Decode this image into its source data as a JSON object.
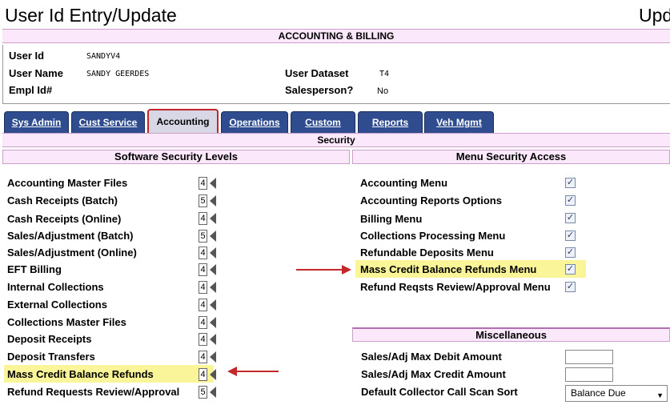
{
  "window": {
    "title": "User Id Entry/Update",
    "title_right": "Upd"
  },
  "section": {
    "title": "ACCOUNTING & BILLING"
  },
  "user_info": {
    "user_id_label": "User Id",
    "user_id_value": "SANDYV4",
    "user_name_label": "User Name",
    "user_name_value": "SANDY GEERDES",
    "empl_id_label": "Empl Id#",
    "user_dataset_label": "User Dataset",
    "user_dataset_value": "T4",
    "salesperson_label": "Salesperson?",
    "salesperson_value": "No"
  },
  "tabs": [
    {
      "label": "Sys Admin",
      "active": false
    },
    {
      "label": "Cust Service",
      "active": false
    },
    {
      "label": "Accounting",
      "active": true
    },
    {
      "label": "Operations",
      "active": false
    },
    {
      "label": "Custom",
      "active": false
    },
    {
      "label": "Reports",
      "active": false
    },
    {
      "label": "Veh Mgmt",
      "active": false
    }
  ],
  "security": {
    "title": "Security"
  },
  "software_levels": {
    "title": "Software Security Levels",
    "items": [
      {
        "label": "Accounting Master Files",
        "level": "4"
      },
      {
        "label": "Cash Receipts (Batch)",
        "level": "5"
      },
      {
        "label": "Cash Receipts (Online)",
        "level": "4"
      },
      {
        "label": "Sales/Adjustment (Batch)",
        "level": "5"
      },
      {
        "label": "Sales/Adjustment (Online)",
        "level": "4"
      },
      {
        "label": "EFT Billing",
        "level": "4"
      },
      {
        "label": "Internal Collections",
        "level": "4"
      },
      {
        "label": "External Collections",
        "level": "4"
      },
      {
        "label": "Collections Master Files",
        "level": "4"
      },
      {
        "label": "Deposit Receipts",
        "level": "4"
      },
      {
        "label": "Deposit Transfers",
        "level": "4"
      },
      {
        "label": "Mass Credit Balance Refunds",
        "level": "4",
        "highlighted": true
      },
      {
        "label": "Refund Requests Review/Approval",
        "level": "5"
      }
    ]
  },
  "menu_access": {
    "title": "Menu Security Access",
    "items": [
      {
        "label": "Accounting Menu",
        "checked": true
      },
      {
        "label": "Accounting Reports Options",
        "checked": true
      },
      {
        "label": "Billing Menu",
        "checked": true
      },
      {
        "label": "Collections Processing Menu",
        "checked": true
      },
      {
        "label": "Refundable Deposits Menu",
        "checked": true
      },
      {
        "label": "Mass Credit Balance Refunds Menu",
        "checked": true,
        "highlighted": true
      },
      {
        "label": "Refund Reqsts Review/Approval Menu",
        "checked": true
      }
    ]
  },
  "misc": {
    "title": "Miscellaneous",
    "max_debit_label": "Sales/Adj Max Debit Amount",
    "max_debit_value": "",
    "max_credit_label": "Sales/Adj Max Credit Amount",
    "max_credit_value": "",
    "scan_sort_label": "Default Collector Call Scan Sort",
    "scan_sort_value": "Balance Due"
  },
  "colors": {
    "highlight": "#fbf59a",
    "annotation_arrow": "#c4282a",
    "tab_bg": "#2e4c8e",
    "header_bg": "#fbe8fb"
  },
  "icons": {
    "level_arrow": "left-triangle-icon",
    "dropdown": "chevron-down-icon",
    "checkbox": "check-icon"
  }
}
